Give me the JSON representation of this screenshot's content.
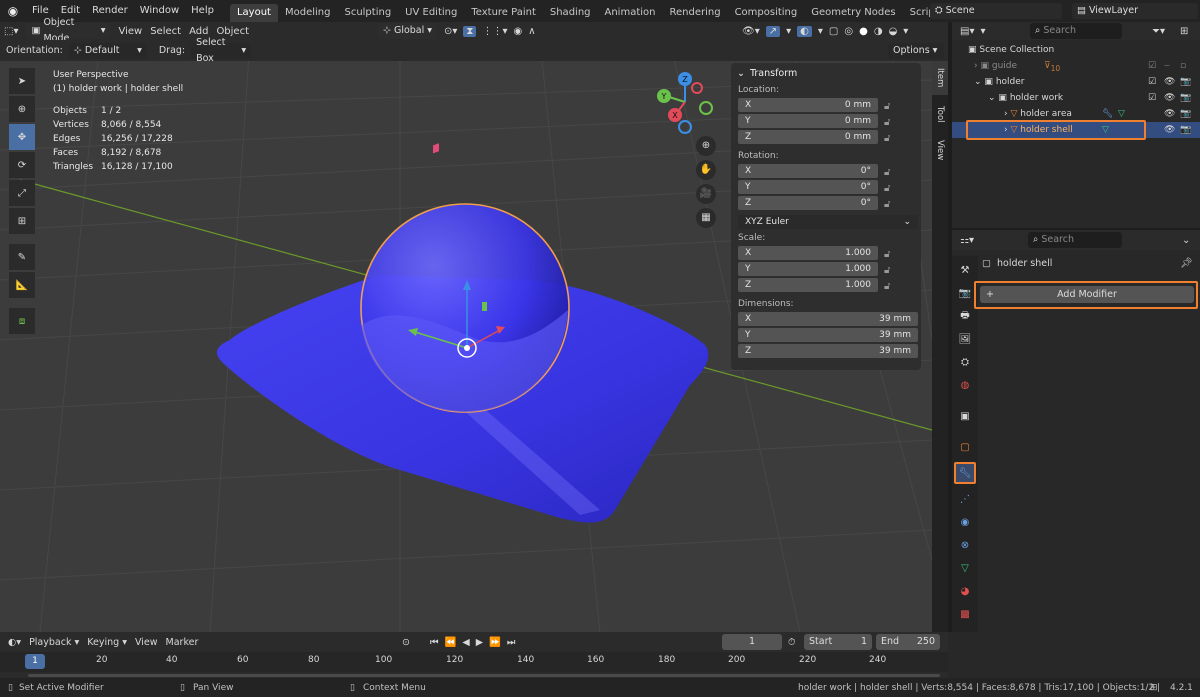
{
  "menu": {
    "items": [
      "File",
      "Edit",
      "Render",
      "Window",
      "Help"
    ]
  },
  "workspaces": [
    "Layout",
    "Modeling",
    "Sculpting",
    "UV Editing",
    "Texture Paint",
    "Shading",
    "Animation",
    "Rendering",
    "Compositing",
    "Geometry Nodes",
    "Scripting"
  ],
  "scene": {
    "name": "Scene",
    "view_layer": "ViewLayer"
  },
  "header": {
    "mode": "Object Mode",
    "view": "View",
    "select": "Select",
    "add": "Add",
    "object": "Object",
    "transform_orientation": "Global"
  },
  "tool_header": {
    "orientation_label": "Orientation:",
    "orientation_value": "Default",
    "drag_label": "Drag:",
    "drag_value": "Select Box",
    "options": "Options"
  },
  "overlay": {
    "perspective": "User Perspective",
    "context": "(1) holder work | holder shell",
    "stats": [
      {
        "k": "Objects",
        "v": "1 / 2"
      },
      {
        "k": "Vertices",
        "v": "8,066 / 8,554"
      },
      {
        "k": "Edges",
        "v": "16,256 / 17,228"
      },
      {
        "k": "Faces",
        "v": "8,192 / 8,678"
      },
      {
        "k": "Triangles",
        "v": "16,128 / 17,100"
      }
    ]
  },
  "gizmo": {
    "x": "X",
    "y": "Y",
    "z": "Z"
  },
  "npanel": {
    "title": "Transform",
    "location_label": "Location:",
    "rotation_label": "Rotation:",
    "scale_label": "Scale:",
    "dimensions_label": "Dimensions:",
    "rotation_mode": "XYZ Euler",
    "location": [
      {
        "axis": "X",
        "value": "0 mm"
      },
      {
        "axis": "Y",
        "value": "0 mm"
      },
      {
        "axis": "Z",
        "value": "0 mm"
      }
    ],
    "rotation": [
      {
        "axis": "X",
        "value": "0°"
      },
      {
        "axis": "Y",
        "value": "0°"
      },
      {
        "axis": "Z",
        "value": "0°"
      }
    ],
    "scale": [
      {
        "axis": "X",
        "value": "1.000"
      },
      {
        "axis": "Y",
        "value": "1.000"
      },
      {
        "axis": "Z",
        "value": "1.000"
      }
    ],
    "dimensions": [
      {
        "axis": "X",
        "value": "39 mm"
      },
      {
        "axis": "Y",
        "value": "39 mm"
      },
      {
        "axis": "Z",
        "value": "39 mm"
      }
    ],
    "tabs": [
      "Item",
      "Tool",
      "View"
    ]
  },
  "outliner": {
    "search_placeholder": "Search",
    "root": "Scene Collection",
    "guide": "guide",
    "guide_count": "10",
    "holder": "holder",
    "holder_work": "holder work",
    "holder_area": "holder area",
    "holder_shell": "holder shell"
  },
  "properties": {
    "search_placeholder": "Search",
    "object_name": "holder shell",
    "add_modifier": "Add Modifier"
  },
  "timeline": {
    "playback": "Playback",
    "keying": "Keying",
    "view": "View",
    "marker": "Marker",
    "current_frame": "1",
    "start_label": "Start",
    "start": "1",
    "end_label": "End",
    "end": "250",
    "ruler": [
      "1",
      "20",
      "40",
      "60",
      "80",
      "100",
      "120",
      "140",
      "160",
      "180",
      "200",
      "220",
      "240"
    ]
  },
  "status": {
    "left": "Set Active Modifier",
    "middle": "Pan View",
    "right_hint": "Context Menu",
    "info": "holder work | holder shell | Verts:8,554 | Faces:8,678 | Tris:17,100 | Objects:1/2 |",
    "version": "4.2.1"
  },
  "colors": {
    "accent": "#4a6fa5",
    "highlight": "#f08030",
    "mesh": "#3a37e6",
    "selection": "#ffa64d",
    "grid": "#4a4a4a"
  }
}
